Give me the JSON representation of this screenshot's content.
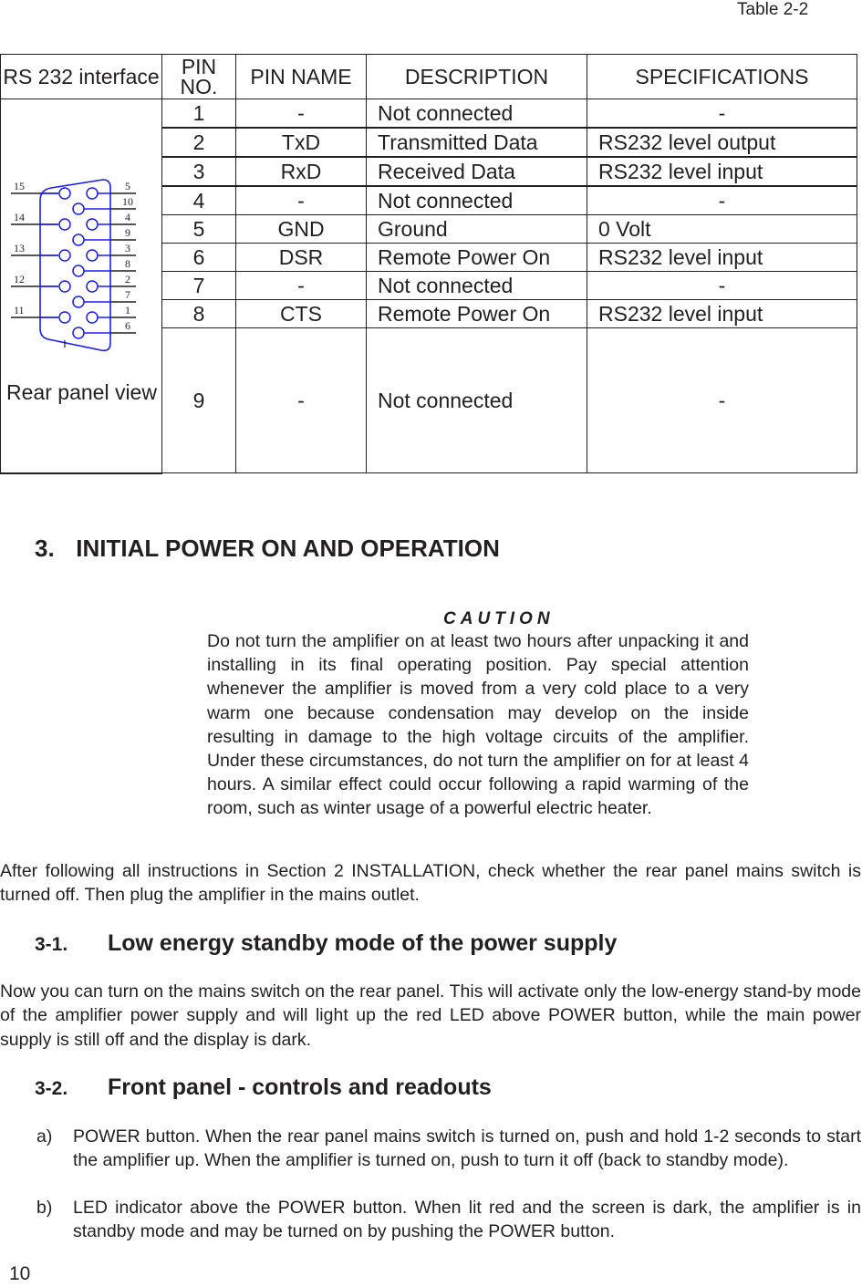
{
  "table": {
    "caption": "Table 2-2",
    "headers": {
      "interface": "RS 232 interface",
      "pin_no": "PIN NO.",
      "pin_name": "PIN NAME",
      "description": "DESCRIPTION",
      "specifications": "SPECIFICATIONS"
    },
    "rear_panel_label": "Rear panel view",
    "connector": {
      "left_pins": [
        "15",
        "14",
        "13",
        "12",
        "11"
      ],
      "right_pins": [
        "5",
        "10",
        "4",
        "9",
        "3",
        "8",
        "2",
        "7",
        "1",
        "6"
      ],
      "shell_color": "#1a1aff"
    },
    "rows": [
      {
        "pin": "1",
        "name": "-",
        "description": "Not connected",
        "spec": "-"
      },
      {
        "pin": "2",
        "name": "TxD",
        "description": "Transmitted Data",
        "spec": "RS232 level output"
      },
      {
        "pin": "3",
        "name": "RxD",
        "description": "Received Data",
        "spec": "RS232 level input"
      },
      {
        "pin": "4",
        "name": "-",
        "description": "Not connected",
        "spec": "-"
      },
      {
        "pin": "5",
        "name": "GND",
        "description": "Ground",
        "spec": "0 Volt"
      },
      {
        "pin": "6",
        "name": "DSR",
        "description": "Remote Power On",
        "spec": "RS232 level input"
      },
      {
        "pin": "7",
        "name": "-",
        "description": "Not connected",
        "spec": "-"
      },
      {
        "pin": "8",
        "name": "CTS",
        "description": "Remote Power On",
        "spec": "RS232 level input"
      },
      {
        "pin": "9",
        "name": "-",
        "description": "Not connected",
        "spec": "-"
      }
    ]
  },
  "section": {
    "number": "3.",
    "title": "INITIAL POWER ON AND OPERATION"
  },
  "caution": {
    "title": "CAUTION",
    "body": "Do not turn the amplifier on at least two hours after unpacking it and installing in its final operating position. Pay special attention whenever the amplifier is moved from a very cold place to a very warm one because condensation may develop on the inside resulting in damage to the high voltage circuits of the amplifier. Under these circumstances, do not turn the amplifier on for at least 4 hours. A similar effect could occur following a rapid warming of the room, such as winter usage of a powerful electric heater."
  },
  "intro_paragraph": "After following all instructions in Section 2 INSTALLATION, check whether the rear panel mains switch is turned off. Then plug the amplifier in the mains outlet.",
  "subsections": [
    {
      "number": "3-1.",
      "title": "Low energy standby mode of the power supply",
      "paragraph": "Now you can turn on the mains switch on the rear panel. This will activate only the low-energy stand-by mode of the amplifier power supply and will light up the red LED above POWER button, while the main power supply is still off and the display is dark."
    },
    {
      "number": "3-2.",
      "title": "Front panel - controls and readouts",
      "items": [
        {
          "mark": "a)",
          "text": "POWER button. When the rear panel mains switch is turned on, push and hold 1-2 seconds to start the amplifier up. When the amplifier is turned on, push to turn it off (back to standby mode)."
        },
        {
          "mark": "b)",
          "text": "LED indicator above the POWER button. When lit red and the screen is dark, the amplifier is in standby mode and may be turned on by pushing the POWER button."
        }
      ]
    }
  ],
  "page_number": "10"
}
